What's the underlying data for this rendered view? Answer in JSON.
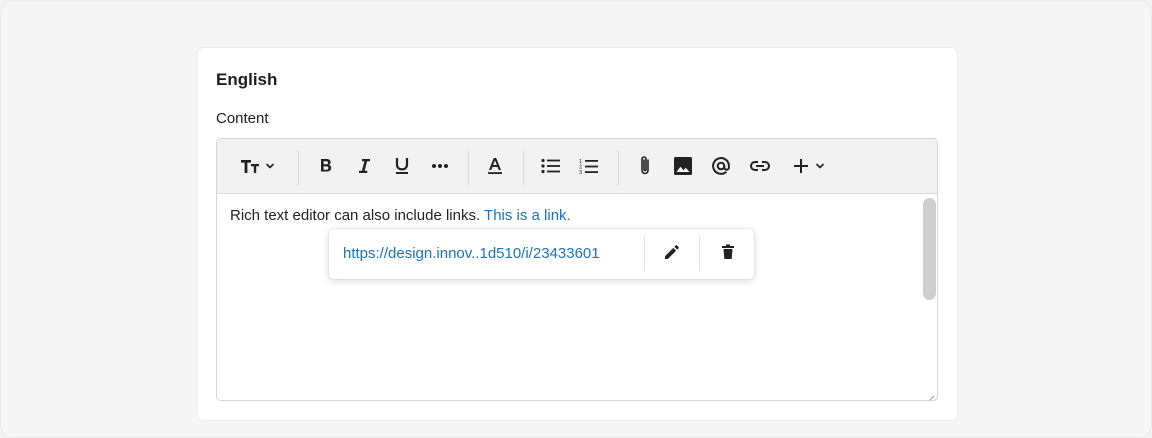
{
  "section": {
    "language_title": "English",
    "field_label": "Content"
  },
  "toolbar": {
    "icons": [
      "text-size-icon",
      "chevron-down-icon",
      "bold-icon",
      "italic-icon",
      "underline-icon",
      "more-icon",
      "text-color-icon",
      "bulleted-list-icon",
      "numbered-list-icon",
      "attachment-icon",
      "image-icon",
      "mention-icon",
      "link-icon",
      "plus-icon",
      "chevron-down-icon"
    ]
  },
  "editor": {
    "text": "Rich text editor can also include links. ",
    "link_text": "This is a link."
  },
  "link_popover": {
    "url": "https://design.innov..1d510/i/23433601",
    "icons": [
      "edit-icon",
      "delete-icon"
    ]
  },
  "colors": {
    "link": "#1a73c8",
    "toolbar_bg": "#f2f2f2",
    "page_bg": "#f5f5f5"
  }
}
